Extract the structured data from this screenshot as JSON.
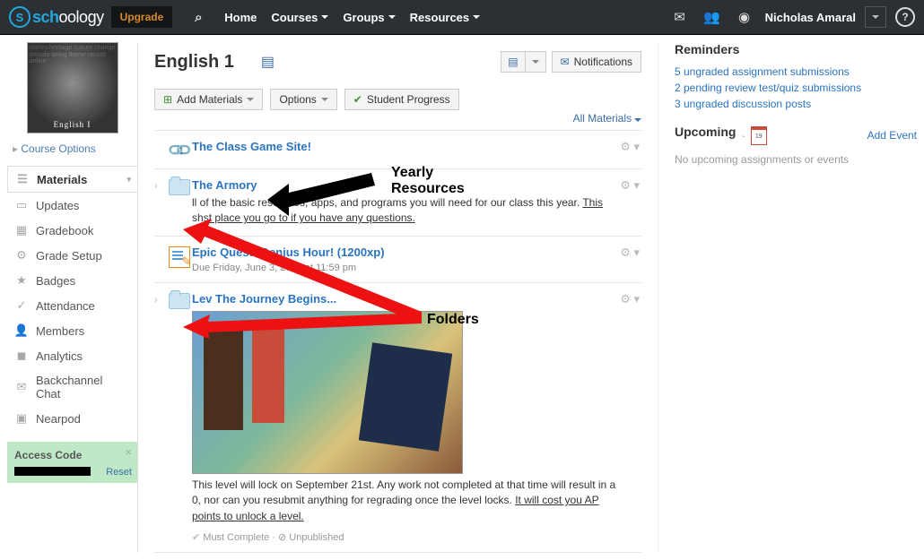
{
  "brand": {
    "name": "schoology"
  },
  "top": {
    "upgrade": "Upgrade",
    "nav": [
      "Home",
      "Courses",
      "Groups",
      "Resources"
    ],
    "user": "Nicholas Amaral"
  },
  "sidebar": {
    "courseImgLabel": "English I",
    "courseOptions": "Course Options",
    "items": [
      {
        "label": "Materials",
        "icon": "☰",
        "active": true
      },
      {
        "label": "Updates",
        "icon": "▭"
      },
      {
        "label": "Gradebook",
        "icon": "▦"
      },
      {
        "label": "Grade Setup",
        "icon": "⚙"
      },
      {
        "label": "Badges",
        "icon": "★"
      },
      {
        "label": "Attendance",
        "icon": "✓"
      },
      {
        "label": "Members",
        "icon": "👤"
      },
      {
        "label": "Analytics",
        "icon": "◼"
      },
      {
        "label": "Backchannel Chat",
        "icon": "✉"
      },
      {
        "label": "Nearpod",
        "icon": "▣"
      }
    ],
    "access": {
      "title": "Access Code",
      "reset": "Reset"
    }
  },
  "header": {
    "title": "English 1",
    "notifications": "Notifications",
    "addMaterials": "Add Materials",
    "options": "Options",
    "studentProgress": "Student Progress",
    "filter": "All Materials"
  },
  "materials": [
    {
      "type": "link",
      "title": "The Class Game Site!"
    },
    {
      "type": "folder",
      "title": "The Armory",
      "desc_pre": "ll of the basic resources, apps, and programs you will need for our class this year. ",
      "desc_und": "This",
      "desc2_pre": "sh",
      "desc2_und": "st place you go to if you have any questions."
    },
    {
      "type": "assignment",
      "title": "Epic Quest: Genius Hour! (1200xp)",
      "sub": "Due Friday, June 3, 2016 at 11:59 pm"
    },
    {
      "type": "folder",
      "title": "Lev        The Journey Begins...",
      "img": true,
      "desc": "This level will lock on September 21st. Any work not completed at that time will result in a 0, nor can you resubmit anything for regrading once the level locks. ",
      "desc_und": "It will cost you AP points to unlock a level.",
      "status": "Must Complete · ⊘ Unpublished"
    }
  ],
  "right": {
    "remTitle": "Reminders",
    "rem": [
      "5 ungraded assignment submissions",
      "2 pending review test/quiz submissions",
      "3 ungraded discussion posts"
    ],
    "upcTitle": "Upcoming",
    "addEvent": "Add Event",
    "empty": "No upcoming assignments or events"
  },
  "anno": {
    "yearly": "Yearly\nResources",
    "folders": "Folders"
  }
}
